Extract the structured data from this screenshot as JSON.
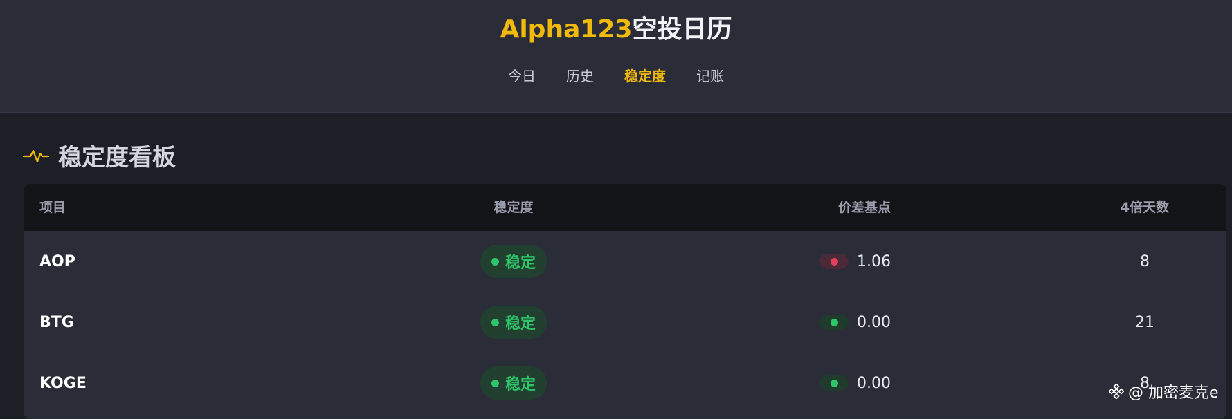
{
  "header": {
    "title_accent": "Alpha123",
    "title_rest": "空投日历",
    "nav": [
      {
        "label": "今日",
        "active": false
      },
      {
        "label": "历史",
        "active": false
      },
      {
        "label": "稳定度",
        "active": true
      },
      {
        "label": "记账",
        "active": false
      }
    ]
  },
  "section": {
    "icon": "activity-pulse-icon",
    "title": "稳定度看板"
  },
  "table": {
    "columns": [
      "项目",
      "稳定度",
      "价差基点",
      "4倍天数"
    ],
    "rows": [
      {
        "name": "AOP",
        "stability": "稳定",
        "spread": "1.06",
        "spread_status": "red",
        "days": "8"
      },
      {
        "name": "BTG",
        "stability": "稳定",
        "spread": "0.00",
        "spread_status": "green",
        "days": "21"
      },
      {
        "name": "KOGE",
        "stability": "稳定",
        "spread": "0.00",
        "spread_status": "green",
        "days": "8"
      }
    ]
  },
  "watermark": {
    "icon": "binance-logo-icon",
    "text": "@ 加密麦克e"
  },
  "colors": {
    "accent": "#f0b90b",
    "stable_green": "#2ec46a",
    "alert_red": "#e0405e",
    "header_bg": "#2a2d38",
    "page_bg": "#1d1f27"
  }
}
